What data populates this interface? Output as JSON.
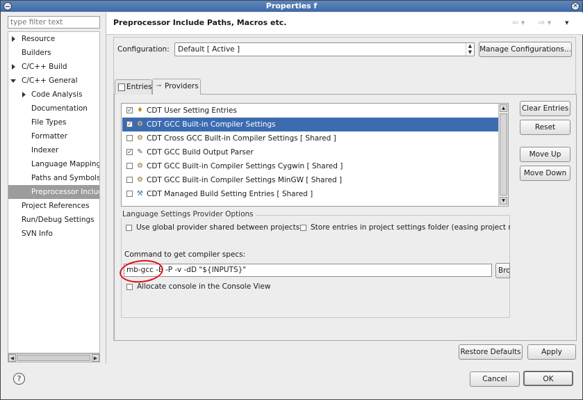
{
  "window": {
    "title": "Properties f"
  },
  "filter": {
    "placeholder": "type filter text"
  },
  "tree": {
    "resource": "Resource",
    "builders": "Builders",
    "cpp_build": "C/C++ Build",
    "cpp_general": "C/C++ General",
    "code_analysis": "Code Analysis",
    "documentation": "Documentation",
    "file_types": "File Types",
    "formatter": "Formatter",
    "indexer": "Indexer",
    "language_mappings": "Language Mappings",
    "paths_symbols": "Paths and Symbols",
    "preprocessor": "Preprocessor Includ",
    "project_references": "Project References",
    "run_debug": "Run/Debug Settings",
    "svn_info": "SVN Info"
  },
  "header": {
    "title": "Preprocessor Include Paths, Macros etc."
  },
  "config": {
    "label": "Configuration:",
    "value": "Default  [ Active ]",
    "manage": "Manage Configurations..."
  },
  "tabs": {
    "entries": "Entries",
    "providers": "Providers"
  },
  "providers": [
    {
      "label": "CDT User Setting Entries",
      "checked": true
    },
    {
      "label": "CDT GCC Built-in Compiler Settings",
      "checked": true
    },
    {
      "label": "CDT Cross GCC Built-in Compiler Settings   [ Shared ]",
      "checked": false
    },
    {
      "label": "CDT GCC Build Output Parser",
      "checked": true
    },
    {
      "label": "CDT GCC Built-in Compiler Settings Cygwin   [ Shared ]",
      "checked": false
    },
    {
      "label": "CDT GCC Built-in Compiler Settings MinGW   [ Shared ]",
      "checked": false
    },
    {
      "label": "CDT Managed Build Setting Entries   [ Shared ]",
      "checked": false
    }
  ],
  "side_buttons": {
    "clear": "Clear Entries",
    "reset": "Reset",
    "move_up": "Move Up",
    "move_down": "Move Down"
  },
  "options": {
    "group_label": "Language Settings Provider Options",
    "use_global": "Use global provider shared between projects",
    "store_entries": "Store entries in project settings folder (easing project mig",
    "command_label": "Command to get compiler specs:",
    "command_value": "mb-gcc -E -P -v -dD \"${INPUTS}\"",
    "browse": "Bro",
    "allocate": "Allocate console in the Console View"
  },
  "bottom": {
    "restore": "Restore Defaults",
    "apply": "Apply",
    "cancel": "Cancel",
    "ok": "OK"
  },
  "colors": {
    "selection": "#3d6bb0",
    "titlebar": "#4a76b0",
    "annotation": "#e0121a"
  }
}
